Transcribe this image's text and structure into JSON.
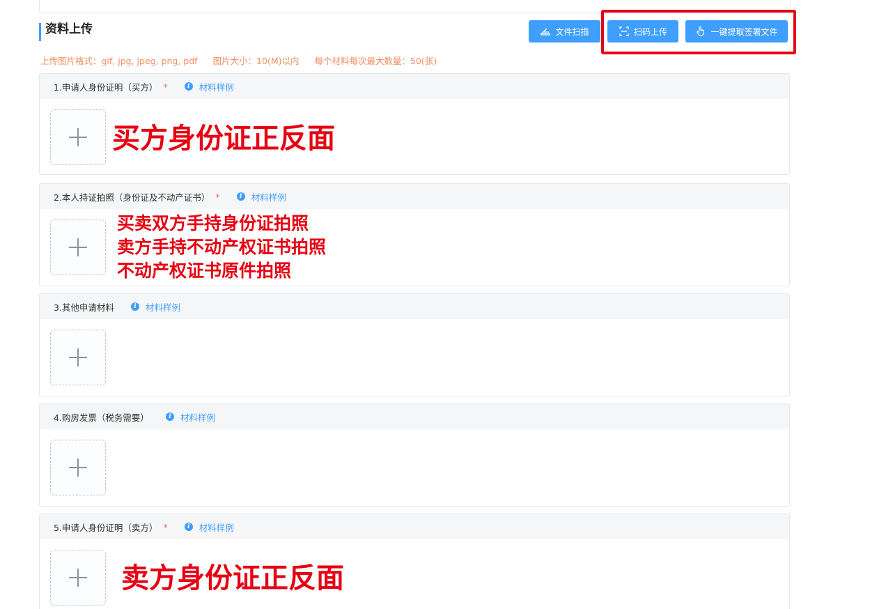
{
  "section": {
    "title": "资料上传"
  },
  "toolbar": {
    "scan_label": "文件扫描",
    "qr_label": "扫码上传",
    "extract_label": "一键提取签署文件"
  },
  "hint": {
    "formats": "上传图片格式：gif, jpg, jpeg, png, pdf",
    "size": "图片大小：10(M)以内",
    "max_count": "每个材料每次最大数量：50(张)"
  },
  "sample_label": "材料样例",
  "materials": [
    {
      "title": "1.申请人身份证明（买方）",
      "required": "*",
      "annotation": "买方身份证正反面"
    },
    {
      "title": "2.本人持证拍照（身份证及不动产证书）",
      "required": "*",
      "annotation_lines": [
        "买卖双方手持身份证拍照",
        "卖方手持不动产权证书拍照",
        "不动产权证书原件拍照"
      ]
    },
    {
      "title": "3.其他申请材料"
    },
    {
      "title": "4.购房发票（税务需要）"
    },
    {
      "title": "5.申请人身份证明（卖方）",
      "required": "*",
      "annotation": "卖方身份证正反面"
    }
  ],
  "colors": {
    "primary": "#409eff",
    "hint": "#f08f60",
    "annotation": "#e60012",
    "required": "#f56c6c"
  }
}
